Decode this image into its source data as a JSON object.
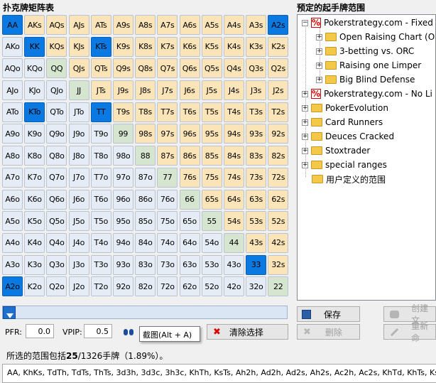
{
  "matrix_title": "扑克牌矩阵表",
  "grid": [
    [
      "AA",
      "AKs",
      "AQs",
      "AJs",
      "ATs",
      "A9s",
      "A8s",
      "A7s",
      "A6s",
      "A5s",
      "A4s",
      "A3s",
      "A2s"
    ],
    [
      "AKo",
      "KK",
      "KQs",
      "KJs",
      "KTs",
      "K9s",
      "K8s",
      "K7s",
      "K6s",
      "K5s",
      "K4s",
      "K3s",
      "K2s"
    ],
    [
      "AQo",
      "KQo",
      "QQ",
      "QJs",
      "QTs",
      "Q9s",
      "Q8s",
      "Q7s",
      "Q6s",
      "Q5s",
      "Q4s",
      "Q3s",
      "Q2s"
    ],
    [
      "AJo",
      "KJo",
      "QJo",
      "JJ",
      "JTs",
      "J9s",
      "J8s",
      "J7s",
      "J6s",
      "J5s",
      "J4s",
      "J3s",
      "J2s"
    ],
    [
      "ATo",
      "KTo",
      "QTo",
      "JTo",
      "TT",
      "T9s",
      "T8s",
      "T7s",
      "T6s",
      "T5s",
      "T4s",
      "T3s",
      "T2s"
    ],
    [
      "A9o",
      "K9o",
      "Q9o",
      "J9o",
      "T9o",
      "99",
      "98s",
      "97s",
      "96s",
      "95s",
      "94s",
      "93s",
      "92s"
    ],
    [
      "A8o",
      "K8o",
      "Q8o",
      "J8o",
      "T8o",
      "98o",
      "88",
      "87s",
      "86s",
      "85s",
      "84s",
      "83s",
      "82s"
    ],
    [
      "A7o",
      "K7o",
      "Q7o",
      "J7o",
      "T7o",
      "97o",
      "87o",
      "77",
      "76s",
      "75s",
      "74s",
      "73s",
      "72s"
    ],
    [
      "A6o",
      "K6o",
      "Q6o",
      "J6o",
      "T6o",
      "96o",
      "86o",
      "76o",
      "66",
      "65s",
      "64s",
      "63s",
      "62s"
    ],
    [
      "A5o",
      "K5o",
      "Q5o",
      "J5o",
      "T5o",
      "95o",
      "85o",
      "75o",
      "65o",
      "55",
      "54s",
      "53s",
      "52s"
    ],
    [
      "A4o",
      "K4o",
      "Q4o",
      "J4o",
      "T4o",
      "94o",
      "84o",
      "74o",
      "64o",
      "54o",
      "44",
      "43s",
      "42s"
    ],
    [
      "A3o",
      "K3o",
      "Q3o",
      "J3o",
      "T3o",
      "93o",
      "83o",
      "73o",
      "63o",
      "53o",
      "43o",
      "33",
      "32s"
    ],
    [
      "A2o",
      "K2o",
      "Q2o",
      "J2o",
      "T2o",
      "92o",
      "82o",
      "72o",
      "62o",
      "52o",
      "42o",
      "32o",
      "22"
    ]
  ],
  "selected": [
    "AA",
    "A2s",
    "KK",
    "KTs",
    "KTo",
    "TT",
    "33",
    "A2o"
  ],
  "colors": {
    "pair": "#d6e5cf",
    "suited": "#fbe5b8",
    "offsuit": "#e5ecf5",
    "selected": "#0a7ae2"
  },
  "controls": {
    "pfr_label": "PFR:",
    "pfr_value": "0.0",
    "vpip_label": "VPIP:",
    "vpip_value": "0.5",
    "tooltip": "截图(Alt + A)",
    "clear_label": "清除选择"
  },
  "slider": {
    "value": 0,
    "thumb_icon": "arrow-down-icon"
  },
  "summary": {
    "prefix": "所选的范围包括",
    "count": "25",
    "suffix": "/1326手牌（1.89%）。"
  },
  "hand_list": "AA, KhKs, TdTh, TdTs, ThTs, 3d3h, 3d3c, 3h3c, KhTh, KsTs, Ah2h, Ad2h, Ad2s, Ah2s, Ac2h, Ac2s, KhTd, KhTs, KsTd, KsTh",
  "tree_title": "预定的起手牌范围",
  "tree": {
    "nodes": [
      {
        "label": "Pokerstrategy.com - Fixed",
        "icon": "pokerstrategy-icon",
        "exp": "−"
      },
      {
        "label": "Open Raising Chart (OR",
        "icon": "folder-icon",
        "exp": "+"
      },
      {
        "label": "3-betting vs. ORC",
        "icon": "folder-icon",
        "exp": "+"
      },
      {
        "label": "Raising one Limper",
        "icon": "folder-icon",
        "exp": "+"
      },
      {
        "label": "Big Blind Defense",
        "icon": "folder-icon",
        "exp": "+"
      },
      {
        "label": "Pokerstrategy.com - No Li",
        "icon": "pokerstrategy-icon",
        "exp": "+"
      },
      {
        "label": "PokerEvolution",
        "icon": "folder-icon",
        "exp": "+"
      },
      {
        "label": "Card Runners",
        "icon": "folder-icon",
        "exp": "+"
      },
      {
        "label": "Deuces Cracked",
        "icon": "folder-icon",
        "exp": "+"
      },
      {
        "label": "Stoxtrader",
        "icon": "folder-icon",
        "exp": "+"
      },
      {
        "label": "special ranges",
        "icon": "folder-icon",
        "exp": "+"
      },
      {
        "label": "用户定义的范围",
        "icon": "folder-icon",
        "exp": ""
      }
    ]
  },
  "side_buttons": {
    "save": "保存",
    "create": "创建文",
    "delete": "删除",
    "rename": "重新命"
  }
}
